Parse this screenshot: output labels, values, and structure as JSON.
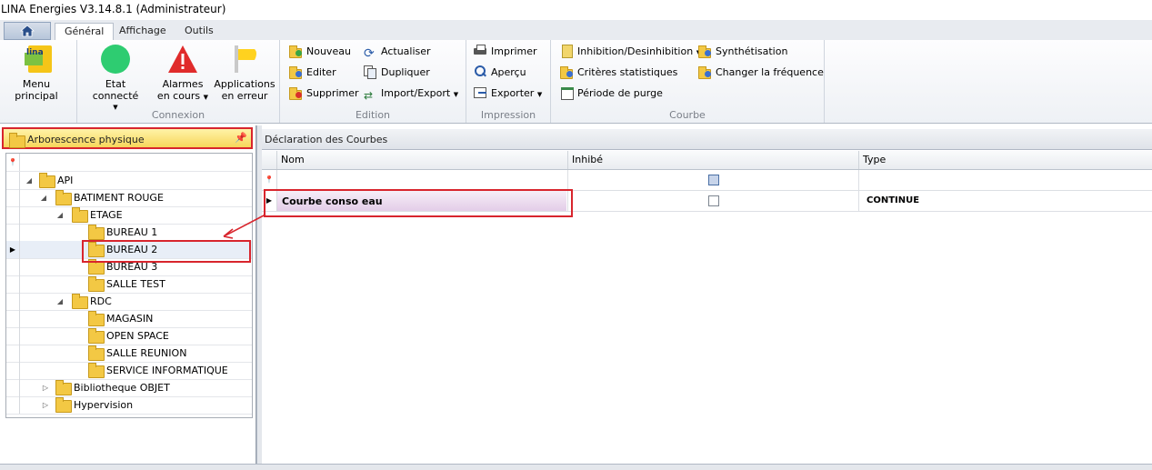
{
  "window": {
    "title": "LINA Energies  V3.14.8.1  (Administrateur)"
  },
  "tabs": [
    {
      "label": "Général"
    },
    {
      "label": "Affichage"
    },
    {
      "label": "Outils"
    }
  ],
  "ribbon": {
    "menu_principal": {
      "label": "Menu principal",
      "logo": "lina"
    },
    "connexion": {
      "group_label": "Connexion",
      "etat": "Etat connecté",
      "alarmes_l1": "Alarmes",
      "alarmes_l2": "en cours",
      "apps_l1": "Applications",
      "apps_l2": "en erreur"
    },
    "edition": {
      "group_label": "Edition",
      "nouveau": "Nouveau",
      "editer": "Editer",
      "supprimer": "Supprimer",
      "actualiser": "Actualiser",
      "dupliquer": "Dupliquer",
      "import_export": "Import/Export"
    },
    "impression": {
      "group_label": "Impression",
      "imprimer": "Imprimer",
      "apercu": "Aperçu",
      "exporter": "Exporter"
    },
    "courbe": {
      "group_label": "Courbe",
      "inhibition": "Inhibition/Desinhibition",
      "criteres": "Critères statistiques",
      "periode": "Période de purge",
      "synthetisation": "Synthétisation",
      "changer_frequence": "Changer la fréquence"
    }
  },
  "left_panel": {
    "title": "Arborescence physique",
    "tree": [
      {
        "label": "API"
      },
      {
        "label": "BATIMENT ROUGE"
      },
      {
        "label": "ETAGE"
      },
      {
        "label": "BUREAU 1"
      },
      {
        "label": "BUREAU 2"
      },
      {
        "label": "BUREAU 3"
      },
      {
        "label": "SALLE TEST"
      },
      {
        "label": "RDC"
      },
      {
        "label": "MAGASIN"
      },
      {
        "label": "OPEN SPACE"
      },
      {
        "label": "SALLE REUNION"
      },
      {
        "label": "SERVICE INFORMATIQUE"
      },
      {
        "label": "Bibliotheque OBJET"
      },
      {
        "label": "Hypervision"
      }
    ]
  },
  "right_panel": {
    "title": "Déclaration des Courbes",
    "columns": [
      "Nom",
      "Inhibé",
      "Type"
    ],
    "rows": [
      {
        "nom": "Courbe conso eau",
        "type": "CONTINUE"
      }
    ]
  },
  "colors": {
    "highlight_red": "#d8252d",
    "connected_green": "#2ecc71",
    "alarm_red": "#e02b2b"
  }
}
